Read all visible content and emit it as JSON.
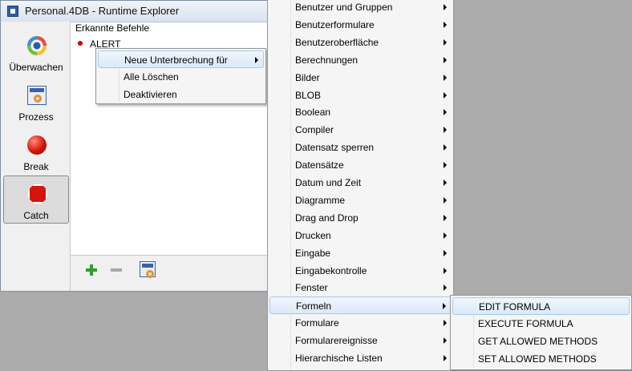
{
  "window": {
    "title": "Personal.4DB - Runtime Explorer",
    "toolbar": [
      {
        "label": "Überwachen",
        "icon": "eye-icon"
      },
      {
        "label": "Prozess",
        "icon": "process-icon"
      },
      {
        "label": "Break",
        "icon": "red-ball-icon"
      },
      {
        "label": "Catch",
        "icon": "stop-sign-icon",
        "selected": true
      }
    ],
    "header": "Erkannte Befehle",
    "list": [
      "ALERT"
    ]
  },
  "context_menu": {
    "items": [
      {
        "label": "Neue Unterbrechung für",
        "submenu": true,
        "highlighted": true
      },
      {
        "label": "Alle Löschen"
      },
      {
        "label": "Deaktivieren"
      }
    ]
  },
  "command_menu": {
    "items": [
      "Benutzer und Gruppen",
      "Benutzerformulare",
      "Benutzeroberfläche",
      "Berechnungen",
      "Bilder",
      "BLOB",
      "Boolean",
      "Compiler",
      "Datensatz sperren",
      "Datensätze",
      "Datum und Zeit",
      "Diagramme",
      "Drag and Drop",
      "Drucken",
      "Eingabe",
      "Eingabekontrolle",
      "Fenster",
      "Formeln",
      "Formulare",
      "Formularereignisse",
      "Hierarchische Listen"
    ],
    "highlighted_index": 17
  },
  "formeln_submenu": {
    "items": [
      "EDIT FORMULA",
      "EXECUTE FORMULA",
      "GET ALLOWED METHODS",
      "SET ALLOWED METHODS"
    ],
    "highlighted_index": 0
  },
  "colors": {
    "highlight": "#dbe9f8",
    "highlight_border": "#a8c8eb",
    "desktop": "#ababab"
  }
}
